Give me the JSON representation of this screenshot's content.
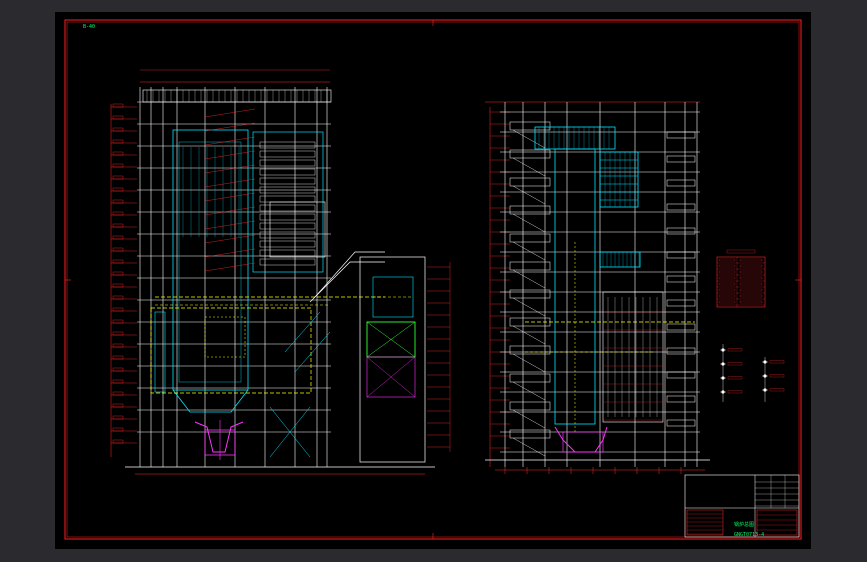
{
  "app": {
    "background": "#2b2b2f",
    "sheet_background": "#000000"
  },
  "sheet": {
    "code_label": "B-40",
    "title_block_caption": "锅炉总图",
    "title_block_drawing_no": "GNGT0713-4"
  },
  "colors": {
    "frame": "#ff2020",
    "boiler_lines": "#ffffff",
    "structure": "#00e5ff",
    "dimensions": "#ff2a2a",
    "centerlines": "#ffff00",
    "hopper": "#ff33ff",
    "ducts": "#33ff33",
    "title_text": "#00ff66"
  },
  "views": [
    {
      "name": "left-elevation",
      "icon": "boiler-front-elevation-icon"
    },
    {
      "name": "right-elevation",
      "icon": "boiler-side-elevation-icon"
    }
  ],
  "legend_table": {
    "icon": "red-legend-table-icon"
  },
  "symbol_key": {
    "icon": "symbol-key-icon"
  }
}
